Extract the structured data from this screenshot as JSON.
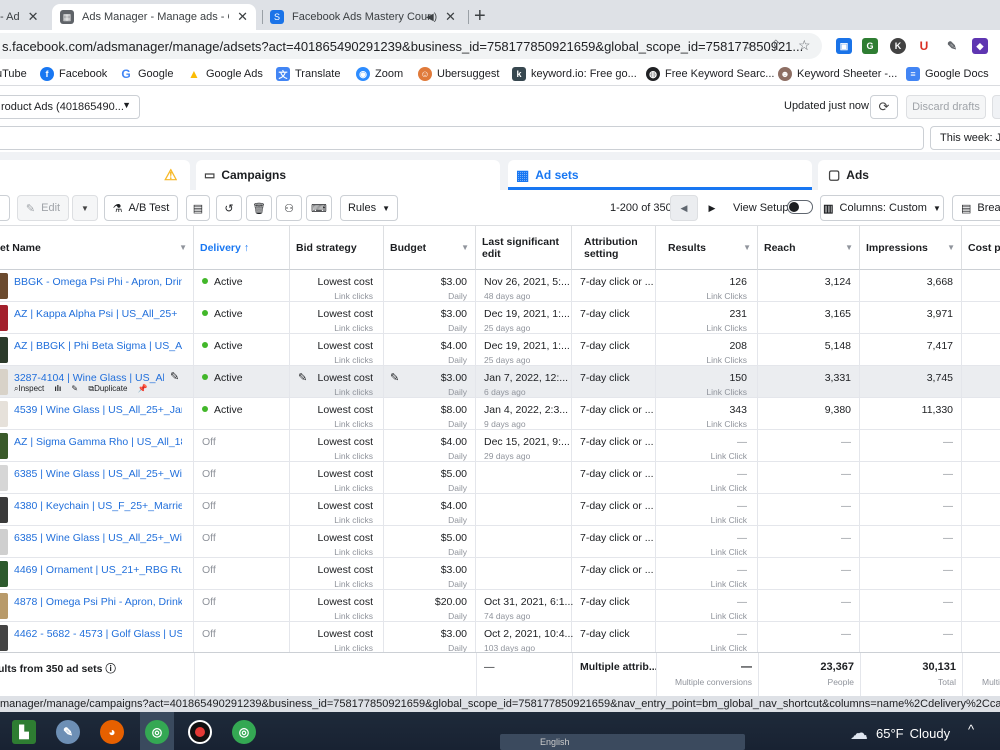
{
  "browser": {
    "tabs": [
      {
        "title": "- Ad"
      },
      {
        "title": "Ads Manager - Manage ads - Ca"
      },
      {
        "title": "Facebook Ads Mastery Cours"
      }
    ],
    "url": "s.facebook.com/adsmanager/manage/adsets?act=401865490291239&business_id=758177850921659&global_scope_id=758177850921...",
    "bookmarks": [
      "uTube",
      "Facebook",
      "Google",
      "Google Ads",
      "Translate",
      "Zoom",
      "Ubersuggest",
      "keyword.io: Free go...",
      "Free Keyword Searc...",
      "Keyword Sheeter -...",
      "Google Docs"
    ],
    "status_url": "manager/manage/campaigns?act=401865490291239&business_id=758177850921659&global_scope_id=758177850921659&nav_entry_point=bm_global_nav_shortcut&columns=name%2Cdelivery%2Ccampaign_name%"
  },
  "topbar": {
    "account": "roduct Ads (401865490...",
    "updated": "Updated just now",
    "discard": "Discard drafts",
    "date_range": "This week: Jan"
  },
  "level_tabs": {
    "campaigns": "Campaigns",
    "adsets": "Ad sets",
    "ads": "Ads"
  },
  "toolbar": {
    "edit": "Edit",
    "ab_test": "A/B Test",
    "rules": "Rules",
    "pagination": "1-200 of 350",
    "view_setup": "View Setup",
    "columns": "Columns: Custom",
    "breakdown": "Break"
  },
  "columns": {
    "name": "et Name",
    "delivery": "Delivery",
    "bid": "Bid strategy",
    "budget": "Budget",
    "last_edit": "Last significant edit",
    "attribution": "Attribution setting",
    "results": "Results",
    "reach": "Reach",
    "impressions": "Impressions",
    "cost": "Cost pe"
  },
  "rows": [
    {
      "name": "BBGK - Omega Psi Phi - Apron, Drinki...",
      "delivery": "Active",
      "bid": "Lowest cost",
      "bid_sub": "Link clicks",
      "budget": "$3.00",
      "budget_sub": "Daily",
      "edit": "Nov 26, 2021, 5:...",
      "edit_sub": "48 days ago",
      "attr": "7-day click or ...",
      "results": "126",
      "results_sub": "Link Clicks",
      "reach": "3,124",
      "impr": "3,668",
      "thumb": "#6b4a2e"
    },
    {
      "name": "AZ | Kappa Alpha Psi | US_All_25+",
      "delivery": "Active",
      "bid": "Lowest cost",
      "bid_sub": "Link clicks",
      "budget": "$3.00",
      "budget_sub": "Daily",
      "edit": "Dec 19, 2021, 1:...",
      "edit_sub": "25 days ago",
      "attr": "7-day click",
      "results": "231",
      "results_sub": "Link Clicks",
      "reach": "3,165",
      "impr": "3,971",
      "thumb": "#a3202c"
    },
    {
      "name": "AZ | BBGK | Phi Beta Sigma | US_All_...",
      "delivery": "Active",
      "bid": "Lowest cost",
      "bid_sub": "Link clicks",
      "budget": "$4.00",
      "budget_sub": "Daily",
      "edit": "Dec 19, 2021, 1:...",
      "edit_sub": "25 days ago",
      "attr": "7-day click",
      "results": "208",
      "results_sub": "Link Clicks",
      "reach": "5,148",
      "impr": "7,417",
      "thumb": "#2b3a2a"
    },
    {
      "name": "3287-4104 | Wine Glass | US_All_2...",
      "delivery": "Active",
      "bid": "Lowest cost",
      "bid_sub": "Link clicks",
      "budget": "$3.00",
      "budget_sub": "Daily",
      "edit": "Jan 7, 2022, 12:...",
      "edit_sub": "6 days ago",
      "attr": "7-day click",
      "results": "150",
      "results_sub": "Link Clicks",
      "reach": "3,331",
      "impr": "3,745",
      "thumb": "#d8d2c8",
      "hover": true
    },
    {
      "name": "4539 | Wine Glass | US_All_25+_Janu...",
      "delivery": "Active",
      "bid": "Lowest cost",
      "bid_sub": "Link clicks",
      "budget": "$8.00",
      "budget_sub": "Daily",
      "edit": "Jan 4, 2022, 2:3...",
      "edit_sub": "9 days ago",
      "attr": "7-day click or ...",
      "results": "343",
      "results_sub": "Link Clicks",
      "reach": "9,380",
      "impr": "11,330",
      "thumb": "#e6e1da"
    },
    {
      "name": "AZ | Sigma Gamma Rho | US_All_18+",
      "delivery": "Off",
      "bid": "Lowest cost",
      "bid_sub": "Link clicks",
      "budget": "$4.00",
      "budget_sub": "Daily",
      "edit": "Dec 15, 2021, 9:...",
      "edit_sub": "29 days ago",
      "attr": "7-day click or ...",
      "results": "—",
      "results_sub": "Link Click",
      "reach": "—",
      "impr": "—",
      "thumb": "#3a5a2a"
    },
    {
      "name": "6385 | Wine Glass | US_All_25+_Wine ...",
      "delivery": "Off",
      "bid": "Lowest cost",
      "bid_sub": "Link clicks",
      "budget": "$5.00",
      "budget_sub": "Daily",
      "edit": "",
      "edit_sub": "",
      "attr": "7-day click or ...",
      "results": "—",
      "results_sub": "Link Click",
      "reach": "—",
      "impr": "—",
      "thumb": "#d6d6d6"
    },
    {
      "name": "4380 | Keychain | US_F_25+_Married, ...",
      "delivery": "Off",
      "bid": "Lowest cost",
      "bid_sub": "Link clicks",
      "budget": "$4.00",
      "budget_sub": "Daily",
      "edit": "",
      "edit_sub": "",
      "attr": "7-day click or ...",
      "results": "—",
      "results_sub": "Link Click",
      "reach": "—",
      "impr": "—",
      "thumb": "#3a3a3a"
    },
    {
      "name": "6385 | Wine Glass | US_All_25+_Wine ...",
      "delivery": "Off",
      "bid": "Lowest cost",
      "bid_sub": "Link clicks",
      "budget": "$5.00",
      "budget_sub": "Daily",
      "edit": "",
      "edit_sub": "",
      "attr": "7-day click or ...",
      "results": "—",
      "results_sub": "Link Click",
      "reach": "—",
      "impr": "—",
      "thumb": "#cfcfcf"
    },
    {
      "name": "4469 | Ornament | US_21+_RBG Ruth ...",
      "delivery": "Off",
      "bid": "Lowest cost",
      "bid_sub": "Link clicks",
      "budget": "$3.00",
      "budget_sub": "Daily",
      "edit": "",
      "edit_sub": "",
      "attr": "7-day click or ...",
      "results": "—",
      "results_sub": "Link Click",
      "reach": "—",
      "impr": "—",
      "thumb": "#2d5a2d"
    },
    {
      "name": "4878 | Omega Psi Phi - Apron, Drinkin...",
      "delivery": "Off",
      "bid": "Lowest cost",
      "bid_sub": "Link clicks",
      "budget": "$20.00",
      "budget_sub": "Daily",
      "edit": "Oct 31, 2021, 6:1...",
      "edit_sub": "74 days ago",
      "attr": "7-day click",
      "results": "—",
      "results_sub": "Link Click",
      "reach": "—",
      "impr": "—",
      "thumb": "#b89a6a"
    },
    {
      "name": "4462 - 5682 - 4573 | Golf Glass | US_...",
      "delivery": "Off",
      "bid": "Lowest cost",
      "bid_sub": "Link clicks",
      "budget": "$3.00",
      "budget_sub": "Daily",
      "edit": "Oct 2, 2021, 10:4...",
      "edit_sub": "103 days ago",
      "attr": "7-day click",
      "results": "—",
      "results_sub": "Link Click",
      "reach": "—",
      "impr": "—",
      "thumb": "#444"
    }
  ],
  "hover_actions": {
    "inspect": "Inspect",
    "duplicate": "Duplicate"
  },
  "summary": {
    "label": "ults from 350 ad sets",
    "edit": "—",
    "attr": "Multiple attrib...",
    "results": "—",
    "results_sub": "Multiple conversions",
    "reach": "23,367",
    "reach_sub": "People",
    "impr": "30,131",
    "impr_sub": "Total",
    "cost_sub": "Multi"
  },
  "taskbar": {
    "temp": "65°F",
    "condition": "Cloudy",
    "center_label": "English"
  },
  "colors": {
    "fb_blue": "#1877f2",
    "active_green": "#42b72a",
    "link_blue": "#216fdb"
  }
}
